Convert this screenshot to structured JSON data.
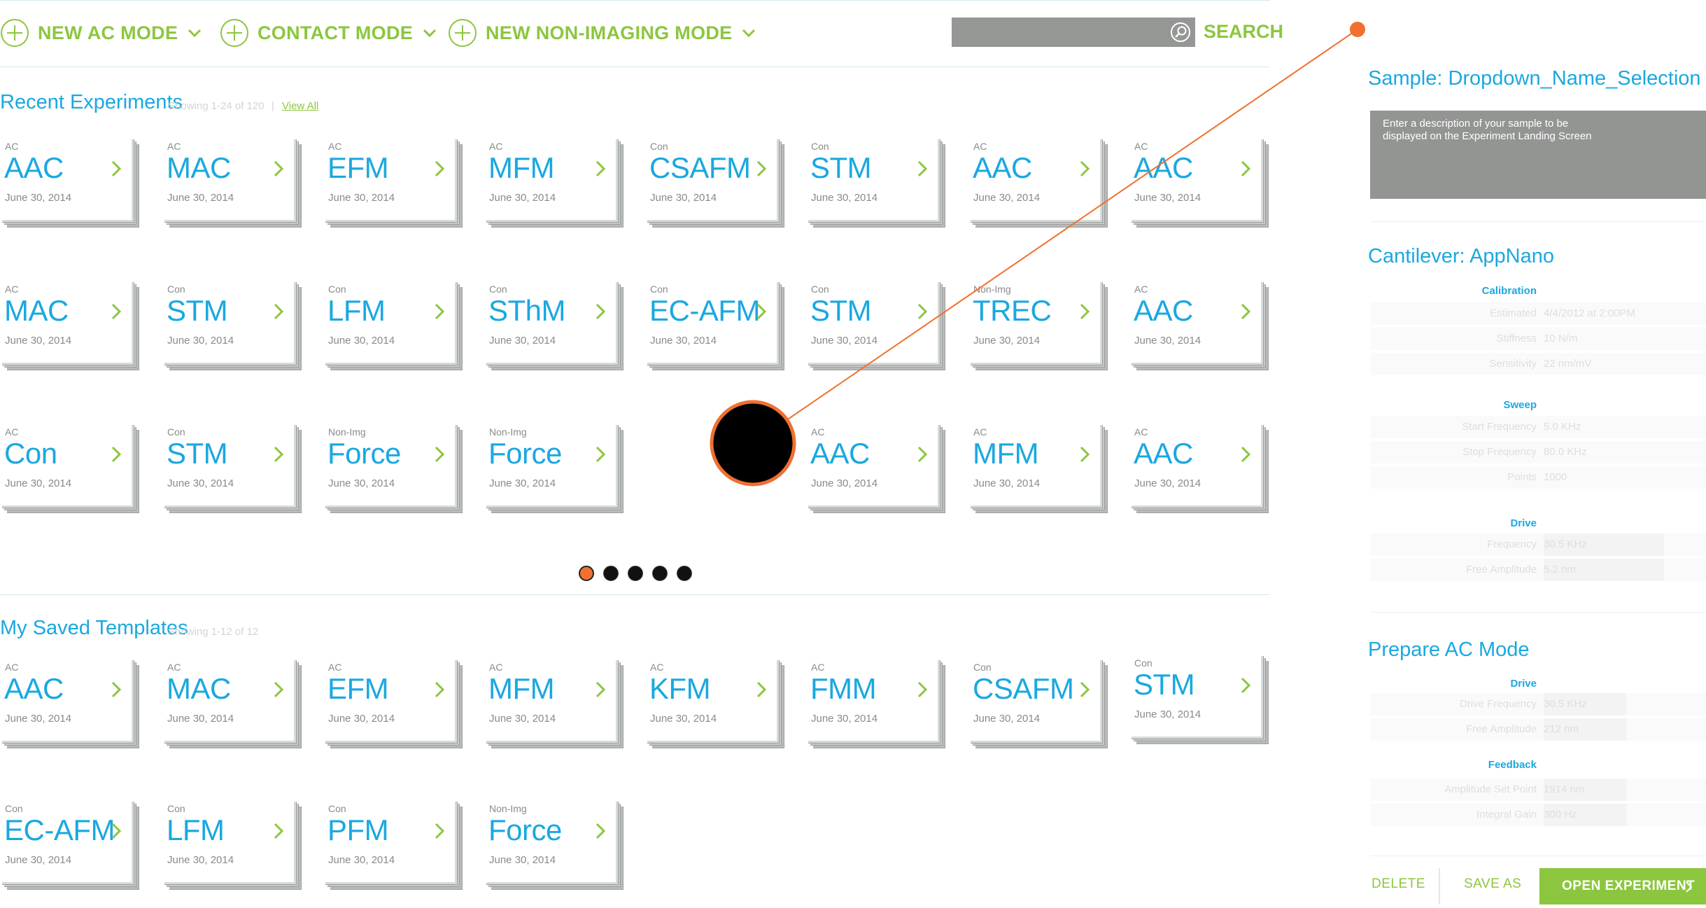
{
  "toolbar": {
    "modes": [
      {
        "label": "NEW AC MODE"
      },
      {
        "label": "CONTACT MODE"
      },
      {
        "label": "NEW NON-IMAGING MODE"
      }
    ],
    "search_label": "SEARCH"
  },
  "recent": {
    "title": "Recent Experiments",
    "showing": "Showing 1-24 of 120",
    "sep": "|",
    "view_all": "View All",
    "cards": [
      {
        "cat": "AC",
        "name": "AAC",
        "date": "June 30, 2014"
      },
      {
        "cat": "AC",
        "name": "MAC",
        "date": "June 30, 2014"
      },
      {
        "cat": "AC",
        "name": "EFM",
        "date": "June 30, 2014"
      },
      {
        "cat": "AC",
        "name": "MFM",
        "date": "June 30, 2014"
      },
      {
        "cat": "Con",
        "name": "CSAFM",
        "date": "June 30, 2014"
      },
      {
        "cat": "Con",
        "name": "STM",
        "date": "June 30, 2014"
      },
      {
        "cat": "AC",
        "name": "AAC",
        "date": "June 30, 2014"
      },
      {
        "cat": "AC",
        "name": "AAC",
        "date": "June 30, 2014"
      },
      {
        "cat": "AC",
        "name": "MAC",
        "date": "June 30, 2014"
      },
      {
        "cat": "Con",
        "name": "STM",
        "date": "June 30, 2014"
      },
      {
        "cat": "Con",
        "name": "LFM",
        "date": "June 30, 2014"
      },
      {
        "cat": "Con",
        "name": "SThM",
        "date": "June 30, 2014"
      },
      {
        "cat": "Con",
        "name": "EC-AFM",
        "date": "June 30, 2014"
      },
      {
        "cat": "Con",
        "name": "STM",
        "date": "June 30, 2014"
      },
      {
        "cat": "Non-Img",
        "name": "TREC",
        "date": "June 30, 2014"
      },
      {
        "cat": "AC",
        "name": "AAC",
        "date": "June 30, 2014"
      },
      {
        "cat": "AC",
        "name": "Con",
        "date": "June 30, 2014"
      },
      {
        "cat": "Con",
        "name": "STM",
        "date": "June 30, 2014"
      },
      {
        "cat": "Non-Img",
        "name": "Force",
        "date": "June 30, 2014"
      },
      {
        "cat": "Non-Img",
        "name": "Force",
        "date": "June 30, 2014"
      },
      {
        "cat": "AC",
        "name": "AAC",
        "date": "June 30, 2014"
      },
      {
        "cat": "AC",
        "name": "MFM",
        "date": "June 30, 2014"
      },
      {
        "cat": "AC",
        "name": "AAC",
        "date": "June 30, 2014"
      }
    ]
  },
  "pager": {
    "pages": 5,
    "active": 1
  },
  "templates": {
    "title": "My Saved Templates",
    "showing": "Showing 1-12 of 12",
    "cards": [
      {
        "cat": "AC",
        "name": "AAC",
        "date": "June 30, 2014"
      },
      {
        "cat": "AC",
        "name": "MAC",
        "date": "June 30, 2014"
      },
      {
        "cat": "AC",
        "name": "EFM",
        "date": "June 30, 2014"
      },
      {
        "cat": "AC",
        "name": "MFM",
        "date": "June 30, 2014"
      },
      {
        "cat": "AC",
        "name": "KFM",
        "date": "June 30, 2014"
      },
      {
        "cat": "AC",
        "name": "FMM",
        "date": "June 30, 2014"
      },
      {
        "cat": "Con",
        "name": "CSAFM",
        "date": "June 30, 2014"
      },
      {
        "cat": "Con",
        "name": "STM",
        "date": "June 30, 2014"
      },
      {
        "cat": "Con",
        "name": "EC-AFM",
        "date": "June 30, 2014"
      },
      {
        "cat": "Con",
        "name": "LFM",
        "date": "June 30, 2014"
      },
      {
        "cat": "Con",
        "name": "PFM",
        "date": "June 30, 2014"
      },
      {
        "cat": "Non-Img",
        "name": "Force",
        "date": "June 30, 2014"
      }
    ]
  },
  "panel": {
    "sample_title": "Sample: Dropdown_Name_Selection",
    "sample_desc": "Enter a description of your sample to be displayed on the Experiment Landing Screen",
    "cantilever_title": "Cantilever: AppNano",
    "calibration": {
      "heading": "Calibration",
      "rows": [
        {
          "label": "Estimated",
          "value": "4/4/2012 at 2:00PM"
        },
        {
          "label": "Stiffness",
          "value": "10 N/m"
        },
        {
          "label": "Sensitivity",
          "value": "22 nm/mV"
        }
      ]
    },
    "sweep": {
      "heading": "Sweep",
      "rows": [
        {
          "label": "Start Frequency",
          "value": "5.0 KHz"
        },
        {
          "label": "Stop Frequency",
          "value": "80.0 KHz"
        },
        {
          "label": "Points",
          "value": "1000"
        }
      ]
    },
    "drive": {
      "heading": "Drive",
      "rows": [
        {
          "label": "Frequency",
          "value": "30.5 KHz"
        },
        {
          "label": "Free Amplitude",
          "value": "5.2 nm"
        }
      ]
    },
    "prepare_title": "Prepare AC Mode",
    "prep_drive": {
      "heading": "Drive",
      "rows": [
        {
          "label": "Drive Frequency",
          "value": "30.5 KHz"
        },
        {
          "label": "Free Amplitude",
          "value": "212 nm"
        }
      ]
    },
    "feedback": {
      "heading": "Feedback",
      "rows": [
        {
          "label": "Amplitude Set Point",
          "value": "1914 nm"
        },
        {
          "label": "Integral Gain",
          "value": "300 Hz"
        }
      ]
    },
    "buttons": {
      "delete": "DELETE",
      "save_as": "SAVE AS",
      "open": "OPEN EXPERIMENT"
    }
  },
  "colors": {
    "accent_green": "#8cc63f",
    "accent_blue": "#1aa8e0",
    "annotation_orange": "#f07030"
  },
  "icons": [
    "plus-circle-icon",
    "chevron-down-icon",
    "search-icon",
    "chevron-right-icon"
  ]
}
